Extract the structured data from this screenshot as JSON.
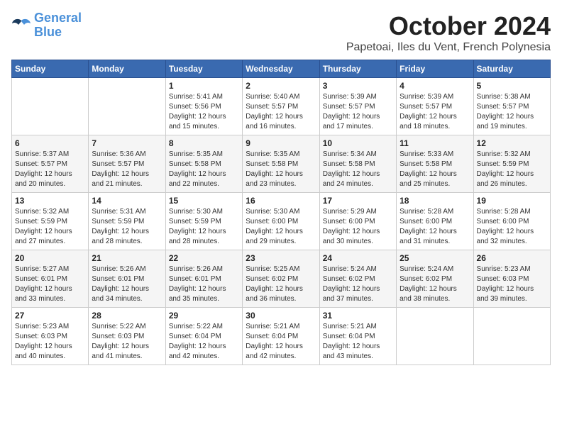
{
  "header": {
    "logo_line1": "General",
    "logo_line2": "Blue",
    "month_year": "October 2024",
    "location": "Papetoai, Iles du Vent, French Polynesia"
  },
  "weekdays": [
    "Sunday",
    "Monday",
    "Tuesday",
    "Wednesday",
    "Thursday",
    "Friday",
    "Saturday"
  ],
  "weeks": [
    [
      {
        "day": "",
        "info": ""
      },
      {
        "day": "",
        "info": ""
      },
      {
        "day": "1",
        "sunrise": "5:41 AM",
        "sunset": "5:56 PM",
        "daylight": "12 hours and 15 minutes."
      },
      {
        "day": "2",
        "sunrise": "5:40 AM",
        "sunset": "5:57 PM",
        "daylight": "12 hours and 16 minutes."
      },
      {
        "day": "3",
        "sunrise": "5:39 AM",
        "sunset": "5:57 PM",
        "daylight": "12 hours and 17 minutes."
      },
      {
        "day": "4",
        "sunrise": "5:39 AM",
        "sunset": "5:57 PM",
        "daylight": "12 hours and 18 minutes."
      },
      {
        "day": "5",
        "sunrise": "5:38 AM",
        "sunset": "5:57 PM",
        "daylight": "12 hours and 19 minutes."
      }
    ],
    [
      {
        "day": "6",
        "sunrise": "5:37 AM",
        "sunset": "5:57 PM",
        "daylight": "12 hours and 20 minutes."
      },
      {
        "day": "7",
        "sunrise": "5:36 AM",
        "sunset": "5:57 PM",
        "daylight": "12 hours and 21 minutes."
      },
      {
        "day": "8",
        "sunrise": "5:35 AM",
        "sunset": "5:58 PM",
        "daylight": "12 hours and 22 minutes."
      },
      {
        "day": "9",
        "sunrise": "5:35 AM",
        "sunset": "5:58 PM",
        "daylight": "12 hours and 23 minutes."
      },
      {
        "day": "10",
        "sunrise": "5:34 AM",
        "sunset": "5:58 PM",
        "daylight": "12 hours and 24 minutes."
      },
      {
        "day": "11",
        "sunrise": "5:33 AM",
        "sunset": "5:58 PM",
        "daylight": "12 hours and 25 minutes."
      },
      {
        "day": "12",
        "sunrise": "5:32 AM",
        "sunset": "5:59 PM",
        "daylight": "12 hours and 26 minutes."
      }
    ],
    [
      {
        "day": "13",
        "sunrise": "5:32 AM",
        "sunset": "5:59 PM",
        "daylight": "12 hours and 27 minutes."
      },
      {
        "day": "14",
        "sunrise": "5:31 AM",
        "sunset": "5:59 PM",
        "daylight": "12 hours and 28 minutes."
      },
      {
        "day": "15",
        "sunrise": "5:30 AM",
        "sunset": "5:59 PM",
        "daylight": "12 hours and 28 minutes."
      },
      {
        "day": "16",
        "sunrise": "5:30 AM",
        "sunset": "6:00 PM",
        "daylight": "12 hours and 29 minutes."
      },
      {
        "day": "17",
        "sunrise": "5:29 AM",
        "sunset": "6:00 PM",
        "daylight": "12 hours and 30 minutes."
      },
      {
        "day": "18",
        "sunrise": "5:28 AM",
        "sunset": "6:00 PM",
        "daylight": "12 hours and 31 minutes."
      },
      {
        "day": "19",
        "sunrise": "5:28 AM",
        "sunset": "6:00 PM",
        "daylight": "12 hours and 32 minutes."
      }
    ],
    [
      {
        "day": "20",
        "sunrise": "5:27 AM",
        "sunset": "6:01 PM",
        "daylight": "12 hours and 33 minutes."
      },
      {
        "day": "21",
        "sunrise": "5:26 AM",
        "sunset": "6:01 PM",
        "daylight": "12 hours and 34 minutes."
      },
      {
        "day": "22",
        "sunrise": "5:26 AM",
        "sunset": "6:01 PM",
        "daylight": "12 hours and 35 minutes."
      },
      {
        "day": "23",
        "sunrise": "5:25 AM",
        "sunset": "6:02 PM",
        "daylight": "12 hours and 36 minutes."
      },
      {
        "day": "24",
        "sunrise": "5:24 AM",
        "sunset": "6:02 PM",
        "daylight": "12 hours and 37 minutes."
      },
      {
        "day": "25",
        "sunrise": "5:24 AM",
        "sunset": "6:02 PM",
        "daylight": "12 hours and 38 minutes."
      },
      {
        "day": "26",
        "sunrise": "5:23 AM",
        "sunset": "6:03 PM",
        "daylight": "12 hours and 39 minutes."
      }
    ],
    [
      {
        "day": "27",
        "sunrise": "5:23 AM",
        "sunset": "6:03 PM",
        "daylight": "12 hours and 40 minutes."
      },
      {
        "day": "28",
        "sunrise": "5:22 AM",
        "sunset": "6:03 PM",
        "daylight": "12 hours and 41 minutes."
      },
      {
        "day": "29",
        "sunrise": "5:22 AM",
        "sunset": "6:04 PM",
        "daylight": "12 hours and 42 minutes."
      },
      {
        "day": "30",
        "sunrise": "5:21 AM",
        "sunset": "6:04 PM",
        "daylight": "12 hours and 42 minutes."
      },
      {
        "day": "31",
        "sunrise": "5:21 AM",
        "sunset": "6:04 PM",
        "daylight": "12 hours and 43 minutes."
      },
      {
        "day": "",
        "info": ""
      },
      {
        "day": "",
        "info": ""
      }
    ]
  ]
}
